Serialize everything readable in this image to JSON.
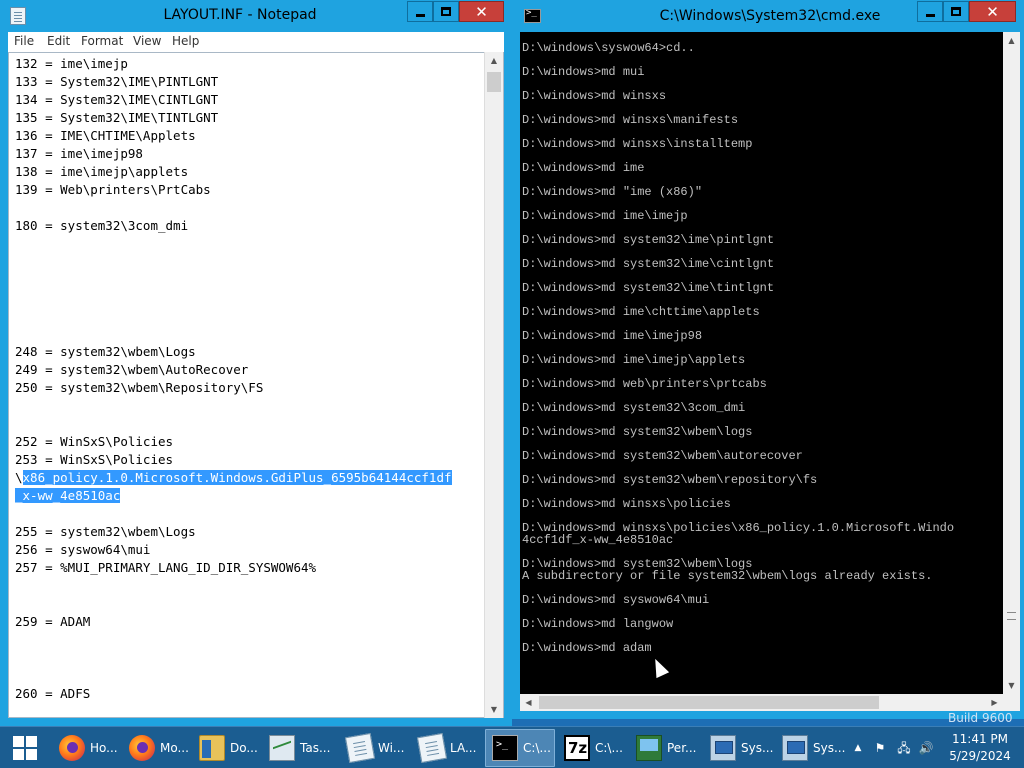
{
  "notepad": {
    "title": "LAYOUT.INF - Notepad",
    "close_glyph": "✕",
    "menu": [
      "File",
      "Edit",
      "Format",
      "View",
      "Help"
    ],
    "lines": [
      "132 = ime\\imejp",
      "133 = System32\\IME\\PINTLGNT",
      "134 = System32\\IME\\CINTLGNT",
      "135 = System32\\IME\\TINTLGNT",
      "136 = IME\\CHTIME\\Applets",
      "137 = ime\\imejp98",
      "138 = ime\\imejp\\applets",
      "139 = Web\\printers\\PrtCabs",
      "",
      "180 = system32\\3com_dmi",
      "",
      "",
      "",
      "",
      "",
      "",
      "248 = system32\\wbem\\Logs",
      "249 = system32\\wbem\\AutoRecover",
      "250 = system32\\wbem\\Repository\\FS",
      "",
      "",
      "252 = WinSxS\\Policies",
      "253 = WinSxS\\Policies"
    ],
    "selected_line_1_prefix": "\\",
    "selected_line_1": "x86_policy.1.0.Microsoft.Windows.GdiPlus_6595b64144ccf1df",
    "selected_line_2": "_x-ww_4e8510ac",
    "lines_after": [
      "",
      "255 = system32\\wbem\\Logs",
      "256 = syswow64\\mui",
      "257 = %MUI_PRIMARY_LANG_ID_DIR_SYSWOW64%",
      "",
      "",
      "259 = ADAM",
      "",
      "",
      "",
      "260 = ADFS"
    ]
  },
  "cmd": {
    "title": "C:\\Windows\\System32\\cmd.exe",
    "close_glyph": "✕",
    "lines": [
      "D:\\windows\\syswow64>cd..",
      "",
      "D:\\windows>md mui",
      "",
      "D:\\windows>md winsxs",
      "",
      "D:\\windows>md winsxs\\manifests",
      "",
      "D:\\windows>md winsxs\\installtemp",
      "",
      "D:\\windows>md ime",
      "",
      "D:\\windows>md \"ime (x86)\"",
      "",
      "D:\\windows>md ime\\imejp",
      "",
      "D:\\windows>md system32\\ime\\pintlgnt",
      "",
      "D:\\windows>md system32\\ime\\cintlgnt",
      "",
      "D:\\windows>md system32\\ime\\tintlgnt",
      "",
      "D:\\windows>md ime\\chttime\\applets",
      "",
      "D:\\windows>md ime\\imejp98",
      "",
      "D:\\windows>md ime\\imejp\\applets",
      "",
      "D:\\windows>md web\\printers\\prtcabs",
      "",
      "D:\\windows>md system32\\3com_dmi",
      "",
      "D:\\windows>md system32\\wbem\\logs",
      "",
      "D:\\windows>md system32\\wbem\\autorecover",
      "",
      "D:\\windows>md system32\\wbem\\repository\\fs",
      "",
      "D:\\windows>md winsxs\\policies",
      "",
      "D:\\windows>md winsxs\\policies\\x86_policy.1.0.Microsoft.Windo",
      "4ccf1df_x-ww_4e8510ac",
      "",
      "D:\\windows>md system32\\wbem\\logs",
      "A subdirectory or file system32\\wbem\\logs already exists.",
      "",
      "D:\\windows>md syswow64\\mui",
      "",
      "D:\\windows>md langwow",
      "",
      "D:\\windows>md adam"
    ]
  },
  "watermark": "Build 9600",
  "taskbar": {
    "items": [
      {
        "label": "Ho...",
        "icon": "firefox-icon"
      },
      {
        "label": "Mo...",
        "icon": "firefox-icon"
      },
      {
        "label": "Do...",
        "icon": "folder-icon"
      },
      {
        "label": "Tas...",
        "icon": "task-manager-icon"
      },
      {
        "label": "Wi...",
        "icon": "notepad-icon"
      },
      {
        "label": "LA...",
        "icon": "notepad-icon"
      },
      {
        "label": "C:\\...",
        "icon": "cmd-icon"
      },
      {
        "label": "C:\\...",
        "icon": "7zip-icon"
      },
      {
        "label": "Per...",
        "icon": "performance-monitor-icon"
      },
      {
        "label": "Sys...",
        "icon": "system-icon"
      },
      {
        "label": "Sys...",
        "icon": "system-icon"
      }
    ],
    "tray": {
      "chevron": "▲",
      "flag": "⚑",
      "network": "🖧",
      "volume": "🔊",
      "time": "11:41 PM",
      "date": "5/29/2024"
    }
  }
}
